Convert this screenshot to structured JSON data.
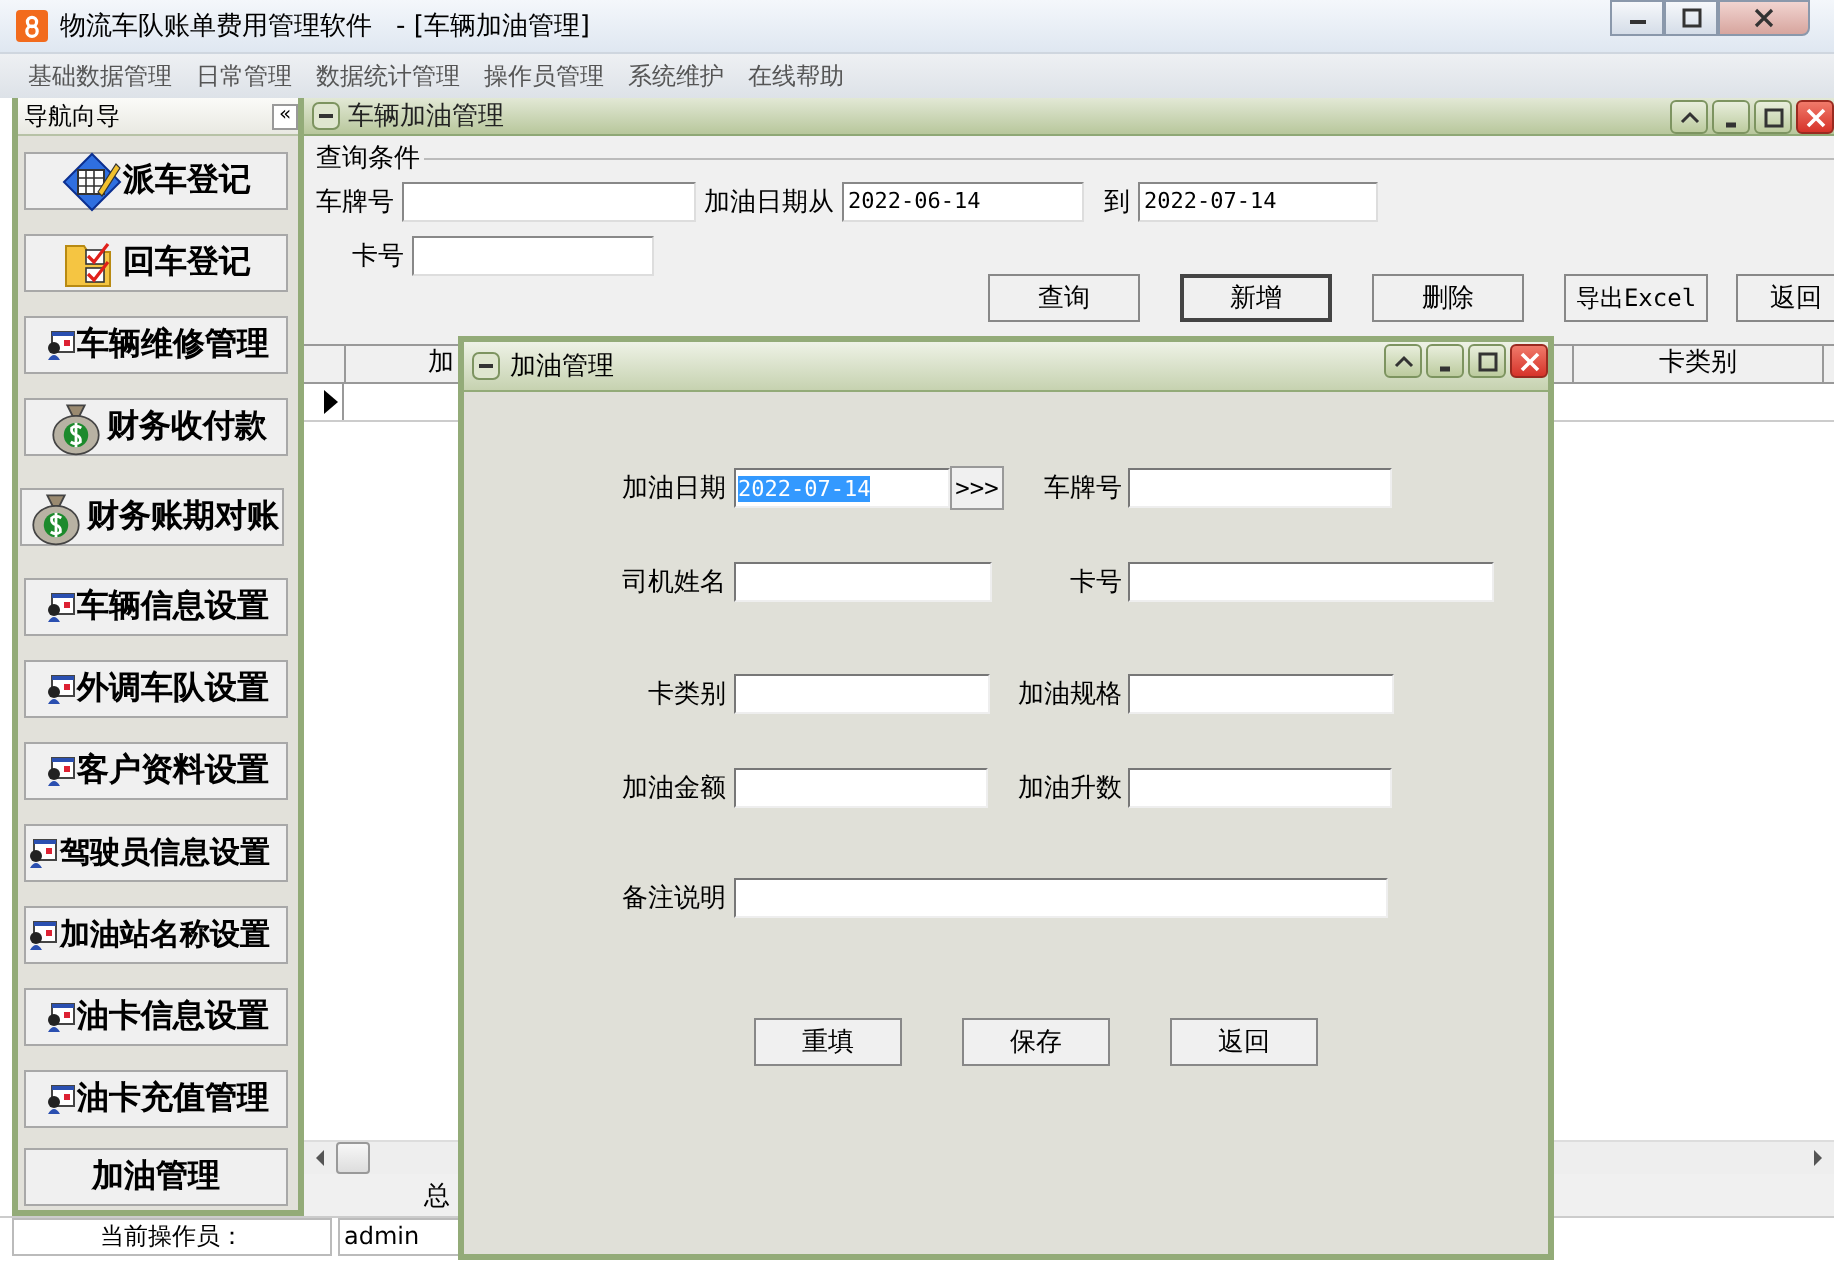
{
  "app": {
    "title": "物流车队账单费用管理软件",
    "document": "- [车辆加油管理]"
  },
  "menu": [
    "基础数据管理",
    "日常管理",
    "数据统计管理",
    "操作员管理",
    "系统维护",
    "在线帮助"
  ],
  "nav": {
    "title": "导航向导",
    "collapse": "«",
    "items": [
      {
        "label": "派车登记",
        "kind": "form"
      },
      {
        "label": "回车登记",
        "kind": "folder"
      },
      {
        "label": "车辆维修管理",
        "kind": "card"
      },
      {
        "label": "财务收付款",
        "kind": "money"
      },
      {
        "label": "财务账期对账",
        "kind": "money"
      },
      {
        "label": "车辆信息设置",
        "kind": "card"
      },
      {
        "label": "外调车队设置",
        "kind": "card"
      },
      {
        "label": "客户资料设置",
        "kind": "card"
      },
      {
        "label": "驾驶员信息设置",
        "kind": "card"
      },
      {
        "label": "加油站名称设置",
        "kind": "card"
      },
      {
        "label": "油卡信息设置",
        "kind": "card"
      },
      {
        "label": "油卡充值管理",
        "kind": "card"
      },
      {
        "label": "加油管理",
        "kind": "plain"
      }
    ]
  },
  "child": {
    "title": "车辆加油管理",
    "query_title": "查询条件",
    "row1": [
      {
        "label": "车牌号"
      },
      {
        "label": "加油日期从",
        "value": "2022-06-14"
      },
      {
        "label": "到",
        "value": "2022-07-14"
      }
    ],
    "row2": [
      {
        "label": "卡号"
      }
    ],
    "buttons": [
      {
        "label": "查询",
        "default": false
      },
      {
        "label": "新增",
        "default": true
      },
      {
        "label": "删除",
        "default": false
      },
      {
        "label": "导出Excel",
        "default": false
      },
      {
        "label": "返回",
        "default": false
      }
    ],
    "columns": [
      "加",
      "卡类别"
    ],
    "footer": "总"
  },
  "dialog": {
    "title": "加油管理",
    "rows": [
      [
        {
          "label": "加油日期",
          "value": "2022-07-14",
          "value_selected": true,
          "picker": ">>>"
        },
        {
          "label": "车牌号"
        }
      ],
      [
        {
          "label": "司机姓名"
        },
        {
          "label": "卡号"
        }
      ],
      [
        {
          "label": "卡类别"
        },
        {
          "label": "加油规格"
        }
      ],
      [
        {
          "label": "加油金额"
        },
        {
          "label": "加油升数"
        }
      ],
      [
        {
          "label": "备注说明"
        }
      ]
    ],
    "buttons": [
      "重填",
      "保存",
      "返回"
    ]
  },
  "status": {
    "label": "当前操作员：",
    "user": "admin"
  }
}
